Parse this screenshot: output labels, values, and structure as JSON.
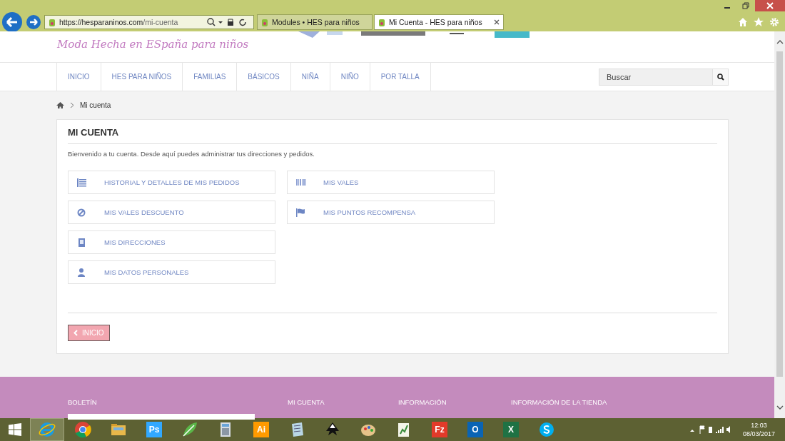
{
  "browser": {
    "url_host": "https://hesparaninos.com",
    "url_path": "/mi-cuenta",
    "tabs": [
      {
        "title": "Modules • HES para niños",
        "selected": false
      },
      {
        "title": "Mi Cuenta - HES para niños",
        "selected": true
      }
    ]
  },
  "site": {
    "logo": "Moda Hecha en ESpaña para niños",
    "nav": [
      {
        "label": "INICIO"
      },
      {
        "label": "HES PARA NIÑOS"
      },
      {
        "label": "FAMILIAS"
      },
      {
        "label": "BÁSICOS"
      },
      {
        "label": "NIÑA"
      },
      {
        "label": "NIÑO"
      },
      {
        "label": "POR TALLA"
      }
    ],
    "search": {
      "placeholder": "Buscar"
    },
    "breadcrumb": "Mi cuenta",
    "heading": "MI CUENTA",
    "welcome": "Bienvenido a tu cuenta. Desde aquí puedes administrar tus direcciones y pedidos.",
    "links_left": [
      {
        "label": "HISTORIAL Y DETALLES DE MIS PEDIDOS",
        "kind": "list"
      },
      {
        "label": "MIS VALES DESCUENTO",
        "kind": "ban"
      },
      {
        "label": "MIS DIRECCIONES",
        "kind": "building"
      },
      {
        "label": "MIS DATOS PERSONALES",
        "kind": "user"
      }
    ],
    "links_right": [
      {
        "label": "MIS VALES",
        "kind": "barcode"
      },
      {
        "label": "MIS PUNTOS RECOMPENSA",
        "kind": "flag"
      }
    ],
    "back_button": "INICIO",
    "footer": [
      "BOLETÍN",
      "MI CUENTA",
      "INFORMACIÓN",
      "INFORMACIÓN DE LA TIENDA"
    ]
  },
  "taskbar": {
    "apps": [
      {
        "kind": "ie",
        "selected": true
      },
      {
        "kind": "chrome",
        "selected": false
      },
      {
        "kind": "folder",
        "selected": false
      },
      {
        "kind": "tile",
        "label": "Ps",
        "color": "#31a8ff",
        "selected": false
      },
      {
        "kind": "leaf",
        "selected": false
      },
      {
        "kind": "calculator",
        "selected": false
      },
      {
        "kind": "tile",
        "label": "Ai",
        "color": "#ff9a00",
        "selected": false
      },
      {
        "kind": "notebook",
        "selected": false
      },
      {
        "kind": "inkscape",
        "selected": false
      },
      {
        "kind": "palette",
        "selected": false
      },
      {
        "kind": "editor",
        "selected": false
      },
      {
        "kind": "tile",
        "label": "Fz",
        "color": "#e23a2a",
        "selected": false
      },
      {
        "kind": "tile",
        "label": "O",
        "color": "#0a64b4",
        "selected": false
      },
      {
        "kind": "tile",
        "label": "X",
        "color": "#1f7244",
        "selected": false
      },
      {
        "kind": "skype",
        "selected": false
      }
    ],
    "time": "12:03",
    "date": "08/03/2017"
  }
}
